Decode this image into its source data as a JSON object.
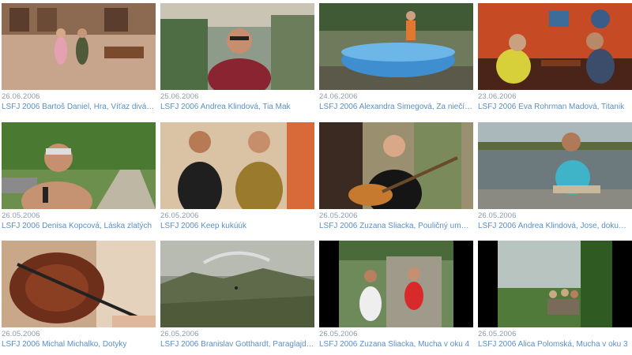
{
  "videos": [
    {
      "date": "26.06.2006",
      "title": "LSFJ 2006 Bartoš Daniel, Hra, Víťaz divác…"
    },
    {
      "date": "25.06.2006",
      "title": "LSFJ 2006 Andrea Klindová, Tia Mak"
    },
    {
      "date": "24.06.2006",
      "title": "LSFJ 2006 Alexandra Šimegová, Za niečí…"
    },
    {
      "date": "23.06.2006",
      "title": "LSFJ 2006 Eva Rohrman Madová, Titanik"
    },
    {
      "date": "26.05.2006",
      "title": "LSFJ 2006 Denisa Kopcová, Láska zlatých"
    },
    {
      "date": "26.05.2006",
      "title": "LSFJ 2006 Keep kukúúk"
    },
    {
      "date": "26.05.2006",
      "title": "LSFJ 2006 Zuzana Sliacka, Pouličný ume…"
    },
    {
      "date": "26.05.2006",
      "title": "LSFJ 2006 Andrea Klindová, Jose, dokum…"
    },
    {
      "date": "26.05.2006",
      "title": "LSFJ 2006 Michal Michalko, Dotyky"
    },
    {
      "date": "26.05.2006",
      "title": "LSFJ 2006 Branislav Gotthardt, Paraglajdi…"
    },
    {
      "date": "26.05.2006",
      "title": "LSFJ 2006 Zuzana Sliacka, Mucha v oku 4"
    },
    {
      "date": "26.05.2006",
      "title": "LSFJ 2006 Alica Polomská, Mucha v oku 3"
    }
  ],
  "colors": {
    "date_text": "#8a9aa8",
    "title_link": "#5b8fc4"
  }
}
